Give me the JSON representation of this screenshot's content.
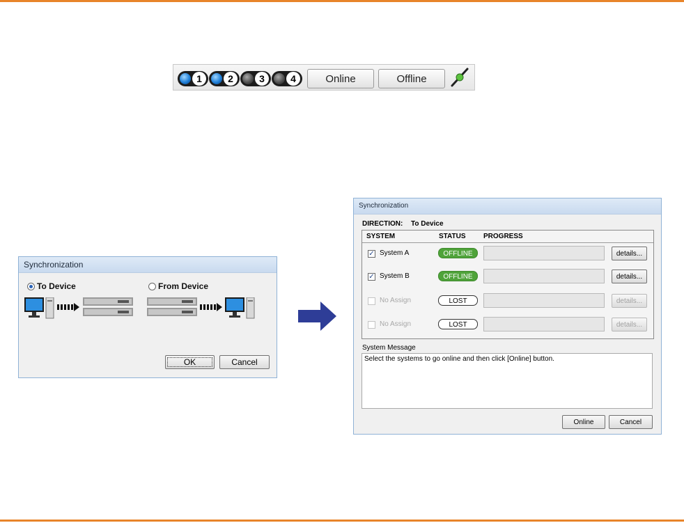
{
  "toolbar": {
    "systems": [
      {
        "num": "1",
        "state": "on"
      },
      {
        "num": "2",
        "state": "on"
      },
      {
        "num": "3",
        "state": "off"
      },
      {
        "num": "4",
        "state": "off"
      }
    ],
    "online_label": "Online",
    "offline_label": "Offline",
    "connect_icon": "plug-connect-icon"
  },
  "sync_small": {
    "title": "Synchronization",
    "to_device_label": "To Device",
    "from_device_label": "From Device",
    "selected": "to_device",
    "ok_label": "OK",
    "cancel_label": "Cancel"
  },
  "sync_main": {
    "title": "Synchronization",
    "direction_label": "DIRECTION:",
    "direction_value": "To Device",
    "columns": {
      "system": "SYSTEM",
      "status": "STATUS",
      "progress": "PROGRESS"
    },
    "rows": [
      {
        "name": "System A",
        "checked": true,
        "enabled": true,
        "status": "OFFLINE",
        "status_kind": "offline",
        "progress": 0,
        "details": "details..."
      },
      {
        "name": "System B",
        "checked": true,
        "enabled": true,
        "status": "OFFLINE",
        "status_kind": "offline",
        "progress": 0,
        "details": "details..."
      },
      {
        "name": "No Assign",
        "checked": false,
        "enabled": false,
        "status": "LOST",
        "status_kind": "lost",
        "progress": 0,
        "details": "details..."
      },
      {
        "name": "No Assign",
        "checked": false,
        "enabled": false,
        "status": "LOST",
        "status_kind": "lost",
        "progress": 0,
        "details": "details..."
      }
    ],
    "message_label": "System Message",
    "message": "Select the systems to go online and then click [Online] button.",
    "online_label": "Online",
    "cancel_label": "Cancel"
  },
  "colors": {
    "accent_rule": "#e8842a",
    "offline": "#4fa33a",
    "arrow": "#2e3d97"
  }
}
